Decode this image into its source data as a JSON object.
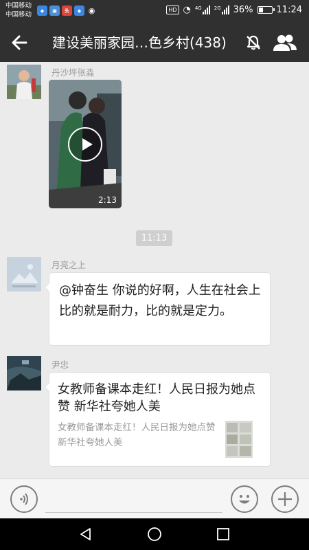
{
  "status_bar": {
    "carrier_1": "中国移动",
    "carrier_2": "中国移动",
    "network": "HD",
    "signal_1": "4G",
    "signal_2": "2G",
    "battery": "36%",
    "battery_level": 0.36,
    "time": "11:24"
  },
  "header": {
    "title": "建设美丽家园…色乡村(438)",
    "back_icon": "back-arrow-icon",
    "mute_icon": "mute-bell-icon",
    "members_icon": "group-members-icon"
  },
  "messages": [
    {
      "sender": "丹沙坪张淼",
      "type": "video",
      "duration": "2:13"
    },
    {
      "type": "timestamp",
      "text": "11:13"
    },
    {
      "sender": "月亮之上",
      "type": "text",
      "text": "@钟奋生  你说的好啊，人生在社会上比的就是耐力，比的就是定力。"
    },
    {
      "sender": "尹忠",
      "type": "link",
      "title": "女教师备课本走红！人民日报为她点赞 新华社夸她人美",
      "description": "女教师备课本走红！人民日报为她点赞 新华社夸她人美"
    }
  ],
  "input_bar": {
    "voice_icon": "voice-input-icon",
    "emoji_icon": "emoji-icon",
    "more_icon": "plus-icon"
  },
  "nav_bar": {
    "back": "nav-back-icon",
    "home": "nav-home-icon",
    "recents": "nav-recents-icon"
  },
  "colors": {
    "title_bar": "#303030",
    "chat_bg": "#ebebeb",
    "bubble": "#ffffff"
  }
}
